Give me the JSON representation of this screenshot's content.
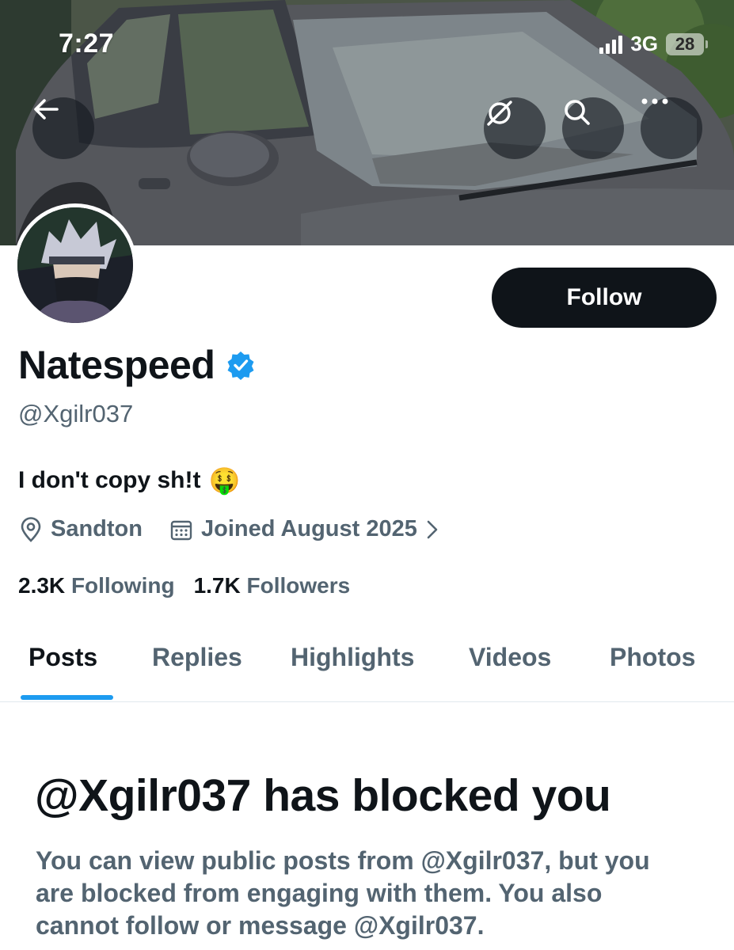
{
  "status_bar": {
    "time": "7:27",
    "network": "3G",
    "battery": "28"
  },
  "header": {
    "back_icon": "arrow-left-icon",
    "actions": [
      "grok-icon",
      "search-icon",
      "more-icon"
    ]
  },
  "profile": {
    "display_name": "Natespeed",
    "verified": true,
    "handle": "@Xgilr037",
    "bio": "I don't copy sh!t",
    "bio_emoji": "🤑",
    "location": "Sandton",
    "joined": "Joined August 2025",
    "following_count": "2.3K",
    "following_label": "Following",
    "followers_count": "1.7K",
    "followers_label": "Followers"
  },
  "follow_button": {
    "label": "Follow"
  },
  "tabs": [
    {
      "label": "Posts",
      "active": true
    },
    {
      "label": "Replies",
      "active": false
    },
    {
      "label": "Highlights",
      "active": false
    },
    {
      "label": "Videos",
      "active": false
    },
    {
      "label": "Photos",
      "active": false
    }
  ],
  "blocked_notice": {
    "title": "@Xgilr037 has blocked you",
    "description": "You can view public posts from @Xgilr037, but you are blocked from engaging with them. You also cannot follow or message @Xgilr037."
  },
  "colors": {
    "accent": "#1d9bf0",
    "text_primary": "#0f1419",
    "text_secondary": "#536471",
    "follow_bg": "#0f1419"
  }
}
